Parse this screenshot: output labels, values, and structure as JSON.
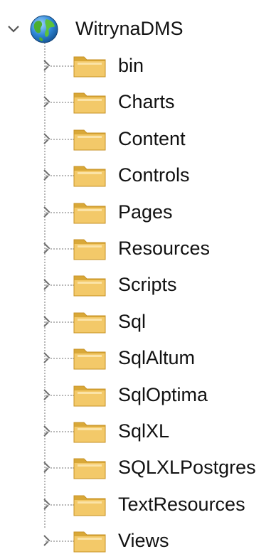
{
  "tree": {
    "root": {
      "label": "WitrynaDMS",
      "icon": "globe-icon",
      "expanded": true
    },
    "children": [
      {
        "label": "bin",
        "icon": "folder-icon"
      },
      {
        "label": "Charts",
        "icon": "folder-icon"
      },
      {
        "label": "Content",
        "icon": "folder-icon"
      },
      {
        "label": "Controls",
        "icon": "folder-icon"
      },
      {
        "label": "Pages",
        "icon": "folder-icon"
      },
      {
        "label": "Resources",
        "icon": "folder-icon"
      },
      {
        "label": "Scripts",
        "icon": "folder-icon"
      },
      {
        "label": "Sql",
        "icon": "folder-icon"
      },
      {
        "label": "SqlAltum",
        "icon": "folder-icon"
      },
      {
        "label": "SqlOptima",
        "icon": "folder-icon"
      },
      {
        "label": "SqlXL",
        "icon": "folder-icon"
      },
      {
        "label": "SQLXLPostgres",
        "icon": "folder-icon"
      },
      {
        "label": "TextResources",
        "icon": "folder-icon"
      },
      {
        "label": "Views",
        "icon": "folder-icon"
      }
    ]
  },
  "colors": {
    "folder_fill": "#f3c969",
    "folder_dark": "#d9a838",
    "chevron": "#6e6e6e",
    "guide": "#b8b8b8"
  }
}
